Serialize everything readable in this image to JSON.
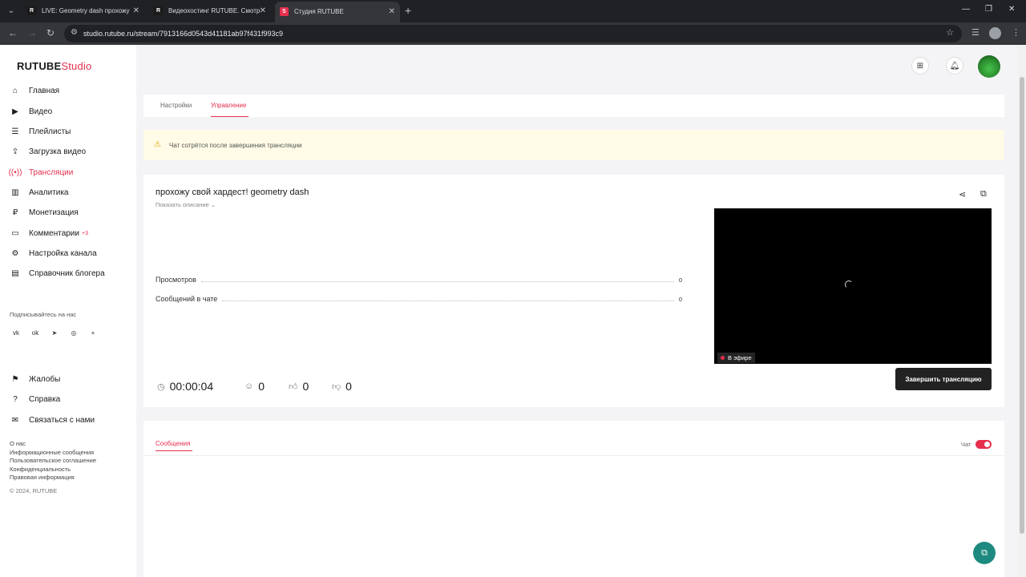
{
  "browser": {
    "tabs": [
      {
        "title": "LIVE: Geometry dash прохожу",
        "favicon": "R"
      },
      {
        "title": "Видеохостинг RUTUBE. Смотр",
        "favicon": "R"
      },
      {
        "title": "Студия RUTUBE",
        "favicon": "S"
      }
    ],
    "url": "studio.rutube.ru/stream/7913166d0543d41181ab97f431f993c9"
  },
  "sidebar": {
    "logo_brand": "RUTUBE",
    "logo_suffix": "Studio",
    "nav": [
      {
        "label": "Главная",
        "icon": "home-icon"
      },
      {
        "label": "Видео",
        "icon": "video-icon"
      },
      {
        "label": "Плейлисты",
        "icon": "playlist-icon"
      },
      {
        "label": "Загрузка видео",
        "icon": "upload-icon"
      },
      {
        "label": "Трансляции",
        "icon": "broadcast-icon"
      },
      {
        "label": "Аналитика",
        "icon": "analytics-icon"
      },
      {
        "label": "Монетизация",
        "icon": "monetization-icon"
      },
      {
        "label": "Комментарии",
        "icon": "comments-icon",
        "badge": "+3"
      },
      {
        "label": "Настройка канала",
        "icon": "channel-settings-icon"
      },
      {
        "label": "Справочник блогера",
        "icon": "handbook-icon"
      }
    ],
    "follow_label": "Подписывайтесь на нас",
    "secondary_nav": [
      {
        "label": "Жалобы",
        "icon": "flag-icon"
      },
      {
        "label": "Справка",
        "icon": "help-icon"
      },
      {
        "label": "Связаться с нами",
        "icon": "mail-icon"
      }
    ],
    "footer_links": [
      "О нас",
      "Информационные сообщения",
      "Пользовательское соглашение",
      "Конфиденциальность",
      "Правовая информация"
    ],
    "copyright": "© 2024, RUTUBE"
  },
  "page_tabs": {
    "settings": "Настройки",
    "manage": "Управление"
  },
  "warning": "Чат сотрётся после завершения трансляции",
  "stream": {
    "title": "прохожу свой хардест! geometry dash",
    "show_description": "Показать описание",
    "stats": [
      {
        "label": "Просмотров",
        "value": "0"
      },
      {
        "label": "Сообщений в чате",
        "value": "0"
      }
    ],
    "live_label": "В эфире",
    "duration": "00:00:04",
    "viewers": "0",
    "likes": "0",
    "dislikes": "0",
    "end_button": "Завершить трансляцию"
  },
  "chat": {
    "tab": "Сообщения",
    "toggle_label": "Чат",
    "toggle_on": true
  },
  "colors": {
    "accent": "#e62e4d",
    "support": "#1e8a7f"
  }
}
